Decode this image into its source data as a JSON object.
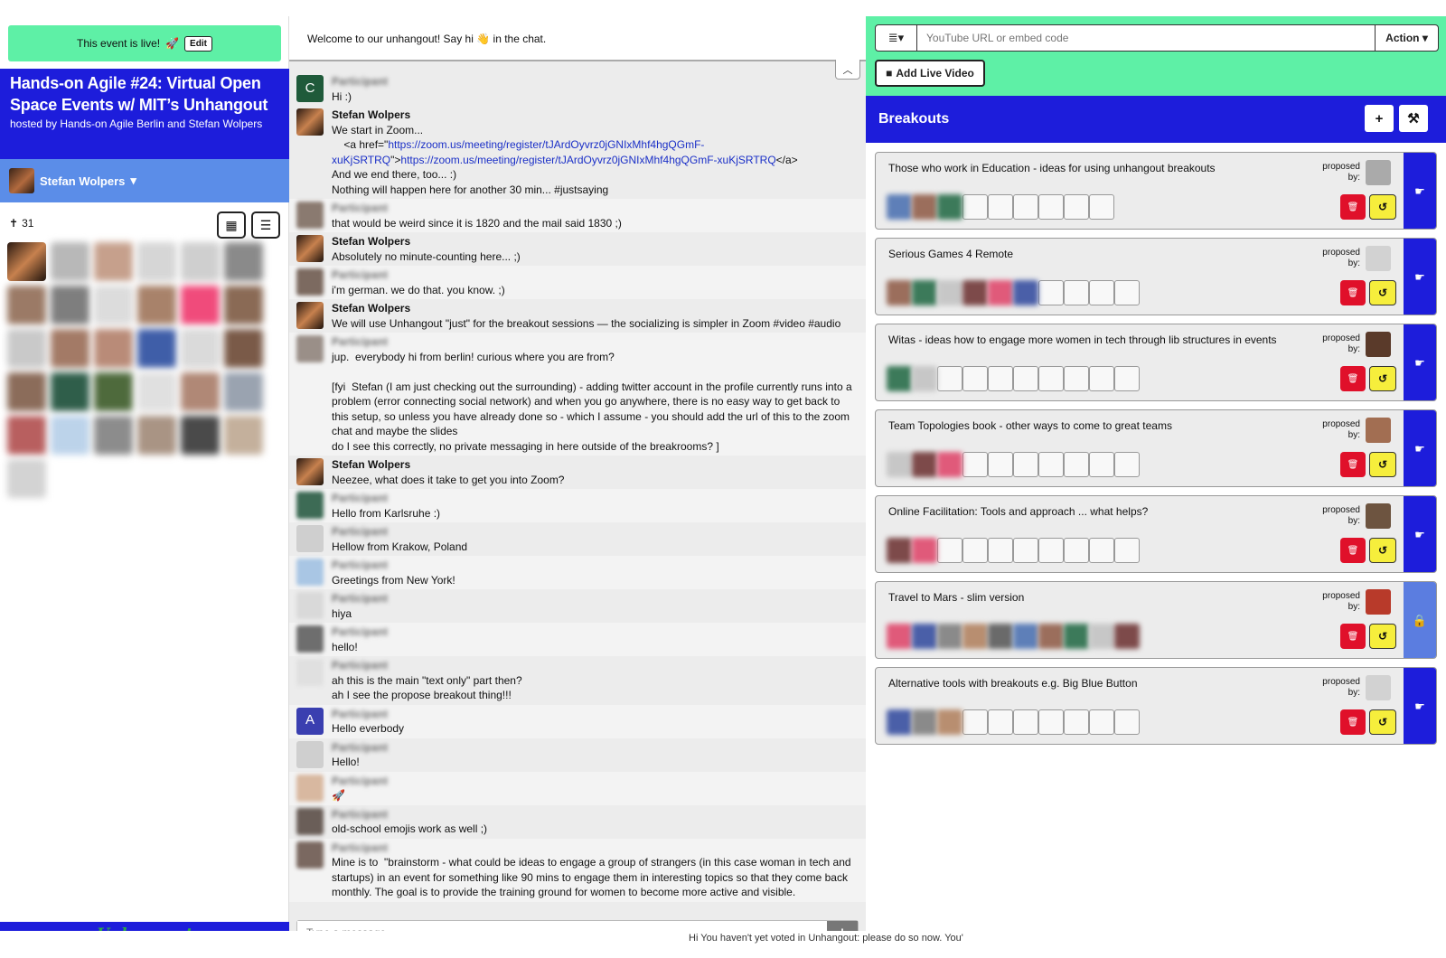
{
  "event": {
    "live_text": "This event is live!",
    "edit_label": "Edit",
    "title": "Hands-on Agile #24: Virtual Open Space Events w/ MIT’s Unhangout",
    "hosted_by": "hosted by Hands-on Agile Berlin and Stefan Wolpers"
  },
  "user": {
    "name": "Stefan Wolpers",
    "chevron": "▾"
  },
  "attendees": {
    "count": "31"
  },
  "footer": {
    "logo_text": "Unhangout"
  },
  "chat": {
    "welcome_before": "Welcome to our unhangout! Say hi ",
    "welcome_emoji": "👋",
    "welcome_after": " in the chat.",
    "input_placeholder": "Type a message...",
    "messages": [
      {
        "name": "",
        "text": "Hi :)"
      },
      {
        "name": "Stefan Wolpers",
        "text": "We start in Zoom..."
      },
      {
        "name": "",
        "text": "And we end there, too... :)"
      },
      {
        "name": "",
        "text": "Nothing will happen here for another 30 min... #justsaying"
      },
      {
        "name": "",
        "text": "that would be weird since it is 1820 and the mail said 1830 ;)"
      },
      {
        "name": "Stefan Wolpers",
        "text": "Absolutely no minute-counting here... ;)"
      },
      {
        "name": "",
        "text": "i'm german. we do that. you know. ;)"
      },
      {
        "name": "Stefan Wolpers",
        "text": "We will use Unhangout \"just\" for the breakout sessions — the socializing is simpler in Zoom #video #audio"
      },
      {
        "name": "",
        "text": "jup.  everybody hi from berlin! curious where you are from?\n\n[fyi  Stefan (I am just checking out the surrounding) - adding twitter account in the profile currently runs into a problem (error connecting social network) and when you go anywhere, there is no easy way to get back to this setup, so unless you have already done so - which I assume - you should add the url of this to the zoom chat and maybe the slides\ndo I see this correctly, no private messaging in here outside of the breakrooms? ]"
      },
      {
        "name": "Stefan Wolpers",
        "text": "Neezee, what does it take to get you into Zoom?"
      },
      {
        "name": "",
        "text": "Hello from Karlsruhe :)"
      },
      {
        "name": "",
        "text": "Hellow from Krakow, Poland"
      },
      {
        "name": "",
        "text": "Greetings from New York!"
      },
      {
        "name": "",
        "text": "hiya"
      },
      {
        "name": "",
        "text": "hello!"
      },
      {
        "name": "",
        "text": "ah this is the main \"text only\" part then?\nah I see the propose breakout thing!!!"
      },
      {
        "name": "",
        "text": "Hello everbody"
      },
      {
        "name": "",
        "text": "Hello!"
      },
      {
        "name": "",
        "text": "🚀"
      },
      {
        "name": "",
        "text": "old-school emojis work as well ;)"
      },
      {
        "name": "",
        "text": "Mine is to  \"brainstorm - what could be ideas to engage a group of strangers (in this case woman in tech and startups) in an event for something like 90 mins to engage them in interesting topics so that they come back monthly. The goal is to provide the training ground for women to become more active and visible."
      }
    ],
    "link_msg": {
      "prefix": "<a href=\"",
      "url": "https://zoom.us/meeting/register/tJArdOyvrz0jGNIxMhf4hgQGmF-xuKjSRTRQ",
      "middle": "\">",
      "suffix": "</a>"
    }
  },
  "video": {
    "url_placeholder": "YouTube URL or embed code",
    "action_label": "Action ▾",
    "menu_label": "≣▾",
    "add_live_label": "Add Live Video"
  },
  "breakouts": {
    "title": "Breakouts",
    "proposed_label": "proposed by:",
    "sessions": [
      {
        "title": "Those who work in Education - ideas for using unhangout breakouts",
        "filled": 3,
        "empty": 6,
        "locked": false
      },
      {
        "title": "Serious Games 4 Remote",
        "filled": 6,
        "empty": 4,
        "locked": false
      },
      {
        "title": "Witas - ideas how to engage more women in tech through lib structures in events",
        "filled": 2,
        "empty": 8,
        "locked": false
      },
      {
        "title": "Team Topologies book - other ways to come to great teams",
        "filled": 3,
        "empty": 7,
        "locked": false
      },
      {
        "title": "Online Facilitation: Tools and approach ... what helps?",
        "filled": 2,
        "empty": 8,
        "locked": false
      },
      {
        "title": "Travel to Mars - slim version",
        "filled": 10,
        "empty": 0,
        "locked": true
      },
      {
        "title": "Alternative tools with breakouts e.g. Big Blue Button",
        "filled": 3,
        "empty": 7,
        "locked": false
      }
    ]
  },
  "bottom_banner": "Hi You haven't yet voted in Unhangout: please do so now. You'",
  "colors": {
    "accent_blue": "#1d1ddb",
    "mint": "#5ef0a6",
    "delete_red": "#e0102a",
    "undo_yellow": "#f6ee3c"
  }
}
